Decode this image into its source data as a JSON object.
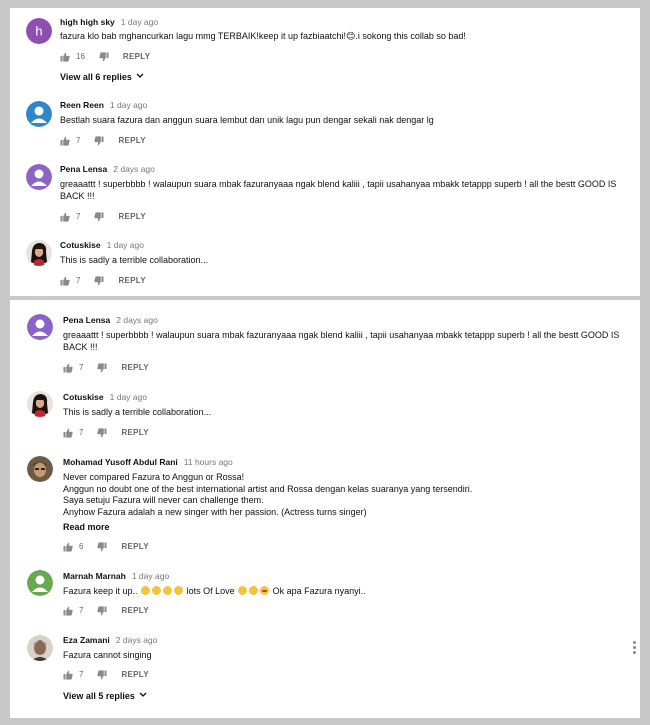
{
  "top_panel": {
    "comments": [
      {
        "author": "high high sky",
        "time": "1 day ago",
        "avatar_letter": "h",
        "avatar_color": "#8e4fb0",
        "lines": [
          "fazura klo bab mghancurkan lagu mmg TERBAIK!keep it up fazbiaatchi!😊.i sokong this collab so bad!"
        ],
        "likes": "16",
        "reply": "REPLY",
        "view_replies": "View all 6 replies"
      },
      {
        "author": "Reen Reen",
        "time": "1 day ago",
        "avatar_color": "#2f86c9",
        "lines": [
          "Bestlah suara fazura dan anggun suara lembut dan unik lagu pun dengar sekali nak dengar lg"
        ],
        "likes": "7",
        "reply": "REPLY"
      },
      {
        "author": "Pena Lensa",
        "time": "2 days ago",
        "avatar_color": "#8b63c8",
        "lines": [
          "greaaattt ! superbbbb ! walaupun suara mbak fazuranyaaa ngak blend kaliii , tapii usahanyaa mbakk tetappp superb ! all the bestt GOOD IS",
          "BACK !!!"
        ],
        "likes": "7",
        "reply": "REPLY"
      },
      {
        "author": "Cotuskise",
        "time": "1 day ago",
        "lines": [
          "This is sadly a terrible collaboration..."
        ],
        "likes": "7",
        "reply": "REPLY"
      }
    ]
  },
  "bottom_panel": {
    "comments": [
      {
        "author": "Pena Lensa",
        "time": "2 days ago",
        "avatar_color": "#8b63c8",
        "lines": [
          "greaaattt ! superbbbb ! walaupun suara mbak fazuranyaaa ngak blend kaliii , tapii usahanyaa mbakk tetappp superb ! all the bestt GOOD IS",
          "BACK !!!"
        ],
        "likes": "7",
        "reply": "REPLY"
      },
      {
        "author": "Cotuskise",
        "time": "1 day ago",
        "lines": [
          "This is sadly a terrible collaboration..."
        ],
        "likes": "7",
        "reply": "REPLY"
      },
      {
        "author": "Mohamad Yusoff Abdul Rani",
        "time": "11 hours ago",
        "lines": [
          "Never compared Fazura to Anggun or Rossa!",
          "Anggun no doubt one of the best international artist and Rossa dengan kelas suaranya  yang tersendiri.",
          "Saya setuju Fazura will never can challenge them.",
          "Anyhow Fazura adalah a new singer with her passion. (Actress turns singer)"
        ],
        "read_more": "Read more",
        "likes": "6",
        "reply": "REPLY"
      },
      {
        "author": "Marnah Marnah",
        "time": "1 day ago",
        "avatar_color": "#6aa84f",
        "line_a": "Fazura keep it up..",
        "line_b": "lots Of Love",
        "line_c": "Ok apa Fazura nyanyi..",
        "likes": "7",
        "reply": "REPLY"
      },
      {
        "author": "Eza Zamani",
        "time": "2 days ago",
        "lines": [
          "Fazura cannot singing"
        ],
        "likes": "7",
        "reply": "REPLY",
        "view_replies": "View all 5 replies"
      }
    ]
  },
  "colors": {
    "page_bg": "#c8c8c8",
    "panel_bg": "#ffffff",
    "meta_text": "#777777",
    "icon_gray": "#8a8a8a"
  },
  "icons": {
    "like": "thumbs-up-icon",
    "dislike": "thumbs-down-icon",
    "expand": "chevron-down-icon",
    "more": "more-vert-icon"
  }
}
